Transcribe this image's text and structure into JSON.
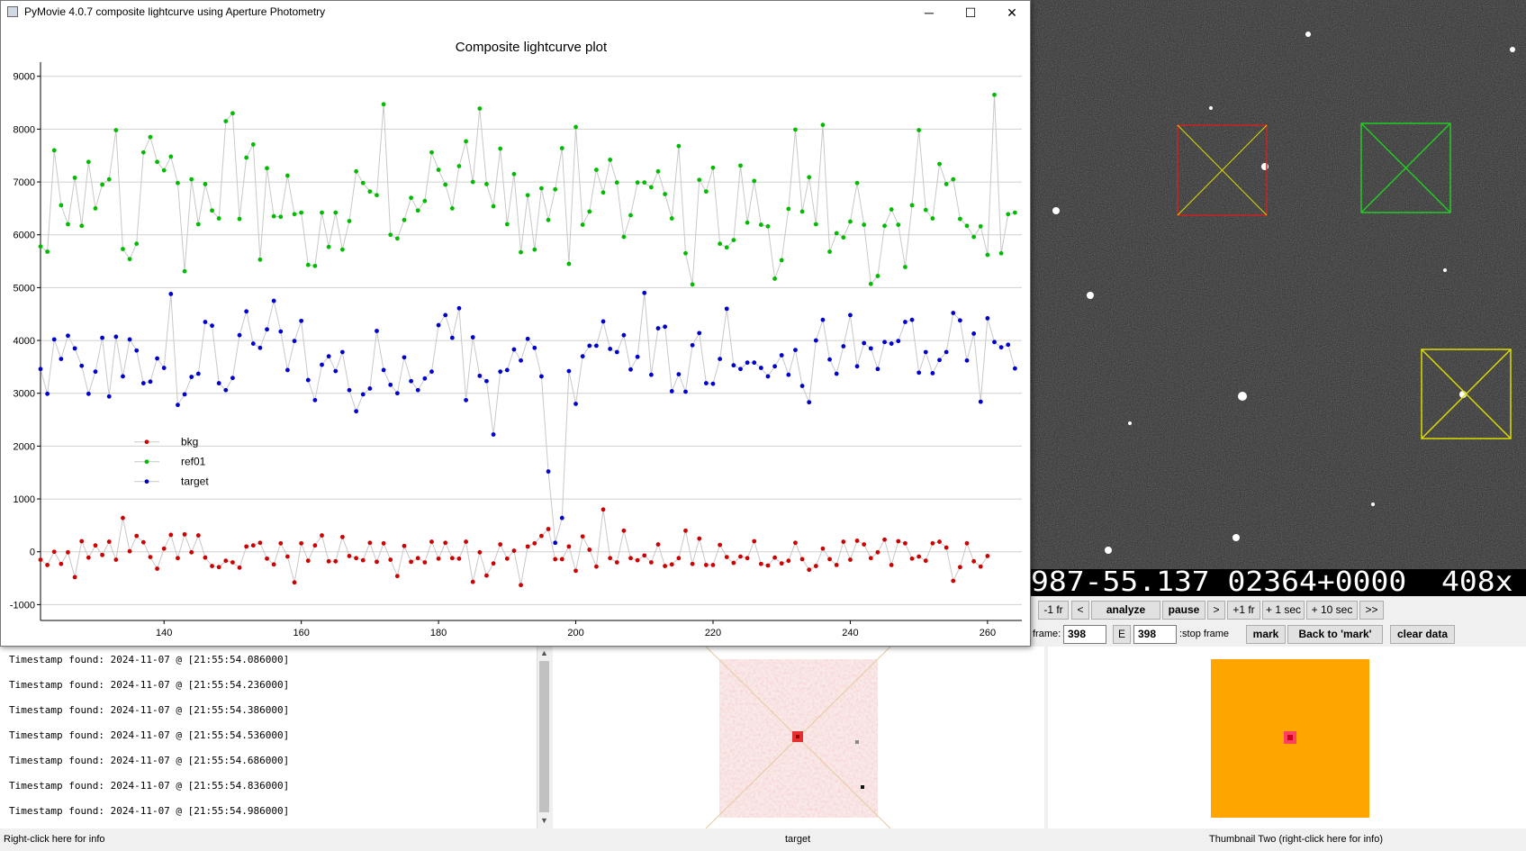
{
  "window": {
    "title": "PyMovie 4.0.7 composite lightcurve using Aperture Photometry",
    "minimize_glyph": "─",
    "maximize_glyph": "☐",
    "close_glyph": "✕"
  },
  "chart_data": {
    "type": "scatter",
    "title": "Composite lightcurve plot",
    "xlabel": "",
    "ylabel": "",
    "xlim": [
      122,
      265
    ],
    "ylim": [
      -1300,
      9200
    ],
    "x_ticks": [
      140,
      160,
      180,
      200,
      220,
      240,
      260
    ],
    "y_ticks": [
      -1000,
      0,
      1000,
      2000,
      3000,
      4000,
      5000,
      6000,
      7000,
      8000,
      9000
    ],
    "grid": "horizontal",
    "legend_position": "center-left",
    "x": [
      122,
      123,
      124,
      125,
      126,
      127,
      128,
      129,
      130,
      131,
      132,
      133,
      134,
      135,
      136,
      137,
      138,
      139,
      140,
      141,
      142,
      143,
      144,
      145,
      146,
      147,
      148,
      149,
      150,
      151,
      152,
      153,
      154,
      155,
      156,
      157,
      158,
      159,
      160,
      161,
      162,
      163,
      164,
      165,
      166,
      167,
      168,
      169,
      170,
      171,
      172,
      173,
      174,
      175,
      176,
      177,
      178,
      179,
      180,
      181,
      182,
      183,
      184,
      185,
      186,
      187,
      188,
      189,
      190,
      191,
      192,
      193,
      194,
      195,
      196,
      197,
      198,
      199,
      200,
      201,
      202,
      203,
      204,
      205,
      206,
      207,
      208,
      209,
      210,
      211,
      212,
      213,
      214,
      215,
      216,
      217,
      218,
      219,
      220,
      221,
      222,
      223,
      224,
      225,
      226,
      227,
      228,
      229,
      230,
      231,
      232,
      233,
      234,
      235,
      236,
      237,
      238,
      239,
      240,
      241,
      242,
      243,
      244,
      245,
      246,
      247,
      248,
      249,
      250,
      251,
      252,
      253,
      254,
      255,
      256,
      257,
      258,
      259,
      260,
      261,
      262,
      263,
      264
    ],
    "series": [
      {
        "name": "bkg",
        "color": "#cc0000",
        "values": [
          -150,
          -250,
          0,
          -230,
          -10,
          -480,
          200,
          -110,
          120,
          -60,
          190,
          -150,
          640,
          10,
          300,
          180,
          -100,
          -320,
          60,
          320,
          -120,
          330,
          -10,
          310,
          -110,
          -270,
          -290,
          -170,
          -200,
          -300,
          100,
          120,
          170,
          -130,
          -240,
          160,
          -90,
          -580,
          160,
          -170,
          120,
          310,
          -180,
          -180,
          280,
          -80,
          -120,
          -160,
          170,
          -190,
          160,
          -150,
          -460,
          110,
          -190,
          -120,
          -200,
          190,
          -130,
          170,
          -120,
          -130,
          190,
          -570,
          -10,
          -450,
          -220,
          140,
          -130,
          20,
          -630,
          100,
          160,
          300,
          430,
          -140,
          -140,
          100,
          -360,
          290,
          40,
          -280,
          800,
          -120,
          -200,
          400,
          -120,
          -160,
          -70,
          -200,
          140,
          -270,
          -240,
          -120,
          400,
          -230,
          250,
          -250,
          -250,
          130,
          -100,
          -210,
          -90,
          -120,
          200,
          -230,
          -260,
          -110,
          -220,
          -170,
          170,
          -140,
          -340,
          -270,
          60,
          -140,
          -250,
          190,
          -150,
          210,
          140,
          -120,
          -10,
          230,
          -250,
          200,
          160,
          -130,
          -90,
          -170,
          160,
          190,
          80,
          -550,
          -290,
          160,
          -180,
          -280,
          -80
        ]
      },
      {
        "name": "ref01",
        "color": "#00bb00",
        "values": [
          5780,
          5680,
          7600,
          6560,
          6200,
          7080,
          6170,
          7380,
          6500,
          6950,
          7050,
          7980,
          5730,
          5540,
          5830,
          7560,
          7850,
          7380,
          7220,
          7480,
          6980,
          5310,
          7050,
          6200,
          6960,
          6460,
          6310,
          8150,
          8300,
          6300,
          7460,
          7710,
          5530,
          7260,
          6350,
          6340,
          7120,
          6390,
          6420,
          5430,
          5410,
          6420,
          5770,
          6420,
          5720,
          6260,
          7200,
          6980,
          6820,
          6750,
          8470,
          6000,
          5930,
          6280,
          6700,
          6460,
          6640,
          7560,
          7230,
          6950,
          6500,
          7300,
          7770,
          7000,
          8390,
          6960,
          6540,
          7630,
          6200,
          7150,
          5670,
          6750,
          5720,
          6880,
          6280,
          6860,
          7640,
          5450,
          8040,
          6190,
          6440,
          7230,
          6800,
          7420,
          6990,
          5960,
          6370,
          6990,
          6990,
          6900,
          7200,
          6770,
          6310,
          7680,
          5650,
          5060,
          7040,
          6820,
          7270,
          5830,
          5760,
          5900,
          7310,
          6230,
          7020,
          6190,
          6160,
          5170,
          5520,
          6490,
          7990,
          6440,
          7090,
          6200,
          8080,
          5680,
          6030,
          5950,
          6250,
          6980,
          6190,
          5070,
          5220,
          6170,
          6480,
          6190,
          5390,
          6560,
          7980,
          6470,
          6310,
          7340,
          6960,
          7050,
          6300,
          6170,
          5960,
          6160,
          5620,
          8650,
          5650,
          6390,
          6420
        ]
      },
      {
        "name": "target",
        "color": "#0000cc",
        "values": [
          3460,
          2990,
          4020,
          3650,
          4090,
          3850,
          3520,
          2990,
          3410,
          4050,
          2940,
          4070,
          3320,
          4020,
          3810,
          3190,
          3220,
          3660,
          3480,
          4880,
          2780,
          2980,
          3310,
          3370,
          4350,
          4280,
          3190,
          3060,
          3290,
          4100,
          4550,
          3940,
          3860,
          4210,
          4750,
          4170,
          3440,
          3990,
          4370,
          3250,
          2870,
          3540,
          3700,
          3420,
          3780,
          3060,
          2660,
          2980,
          3090,
          4180,
          3440,
          3160,
          3000,
          3680,
          3230,
          3060,
          3280,
          3410,
          4290,
          4480,
          4050,
          4610,
          2870,
          4060,
          3330,
          3230,
          2220,
          3410,
          3440,
          3830,
          3620,
          4030,
          3860,
          3320,
          1520,
          170,
          640,
          3420,
          2800,
          3700,
          3900,
          3900,
          4360,
          3840,
          3780,
          4100,
          3450,
          3690,
          4900,
          3350,
          4230,
          4260,
          3040,
          3360,
          3030,
          3910,
          4140,
          3190,
          3180,
          3650,
          4600,
          3530,
          3460,
          3580,
          3580,
          3480,
          3320,
          3510,
          3720,
          3350,
          3820,
          3140,
          2830,
          4000,
          4390,
          3640,
          3370,
          3890,
          4480,
          3510,
          3950,
          3850,
          3460,
          3970,
          3940,
          3990,
          4350,
          4390,
          3390,
          3780,
          3380,
          3630,
          3780,
          4520,
          4380,
          3620,
          4130,
          2840,
          4420,
          3970,
          3870,
          3920,
          3470
        ]
      }
    ]
  },
  "controls": {
    "buttons": [
      "-1 fr",
      "<",
      "analyze",
      "pause",
      ">",
      "+1 fr",
      "+ 1 sec",
      "+ 10 sec",
      ">>"
    ],
    "frame_label": "frame:",
    "frame_value": "398",
    "e_label": "E",
    "stop_value": "398",
    "stop_label": ":stop frame",
    "mark_label": "mark",
    "back_label": "Back to 'mark'",
    "clear_label": "clear data"
  },
  "overlay_text": {
    "left": "987-55.137 02364+0000",
    "right": "408x"
  },
  "log": {
    "lines": [
      "Timestamp found: 2024-11-07 @ [21:55:54.086000]",
      "Timestamp found: 2024-11-07 @ [21:55:54.236000]",
      "Timestamp found: 2024-11-07 @ [21:55:54.386000]",
      "Timestamp found: 2024-11-07 @ [21:55:54.536000]",
      "Timestamp found: 2024-11-07 @ [21:55:54.686000]",
      "Timestamp found: 2024-11-07 @ [21:55:54.836000]",
      "Timestamp found: 2024-11-07 @ [21:55:54.986000]"
    ]
  },
  "footer": {
    "left": "Right-click here for info",
    "center": "target",
    "right": "Thumbnail Two (right-click here for info)"
  },
  "colors": {
    "aperture_red": "#cc2222",
    "aperture_green": "#22cc22",
    "aperture_yellow": "#dddd00",
    "thumb_orange": "#ffa500"
  }
}
